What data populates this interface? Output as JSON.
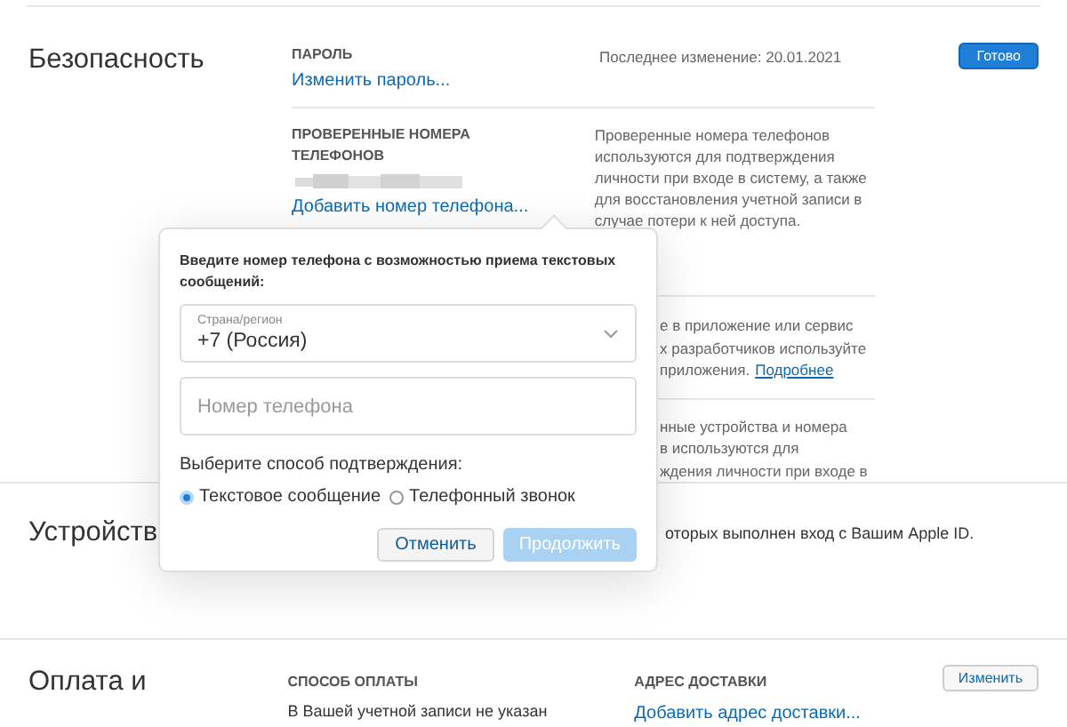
{
  "security": {
    "title": "Безопасность",
    "done_button": "Готово",
    "password": {
      "label": "ПАРОЛЬ",
      "link": "Изменить пароль...",
      "note": "Последнее изменение: 20.01.2021"
    },
    "phones": {
      "label": "ПРОВЕРЕННЫЕ НОМЕРА ТЕЛЕФОНОВ",
      "link": "Добавить номер телефона...",
      "note": "Проверенные номера телефонов используются для подтверждения личности при входе в систему, а также для восстановления учетной записи в случае потери к ней доступа."
    },
    "app_passwords": {
      "lines": [
        "е в приложение или сервис",
        "х разработчиков используйте"
      ],
      "last": "приложения.",
      "more_link": "Подробнее"
    },
    "trusted": {
      "lines": [
        "нные устройства и номера",
        "в используются для",
        "ждения личности при входе в"
      ]
    }
  },
  "devices": {
    "title": "Устройств",
    "note": "оторых выполнен вход с Вашим Apple ID."
  },
  "payment": {
    "title": "Оплата и",
    "method_label": "СПОСОБ ОПЛАТЫ",
    "method_text": "В Вашей учетной записи не указан",
    "address_label": "АДРЕС ДОСТАВКИ",
    "address_link": "Добавить адрес доставки...",
    "edit_button": "Изменить"
  },
  "popover": {
    "heading": "Введите номер телефона с возможностью приема текстовых сообщений:",
    "country": {
      "label": "Страна/регион",
      "value": "+7 (Россия)"
    },
    "phone": {
      "placeholder": "Номер телефона"
    },
    "method_label": "Выберите способ подтверждения:",
    "methods": [
      {
        "label": "Текстовое сообщение",
        "selected": true
      },
      {
        "label": "Телефонный звонок",
        "selected": false
      }
    ],
    "cancel": "Отменить",
    "continue": {
      "label": "Продолжить",
      "disabled": true
    }
  }
}
